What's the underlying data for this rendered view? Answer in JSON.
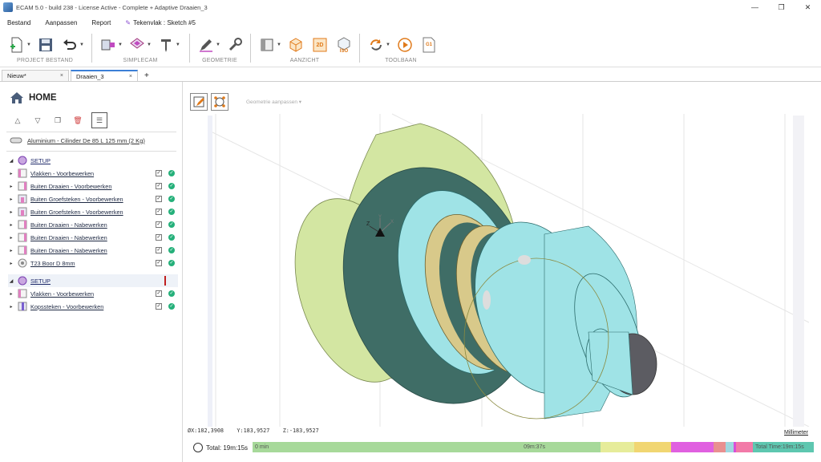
{
  "window": {
    "title": "ECAM 5.0 - build 238 - License Active - Complete + Adaptive Draaien_3",
    "controls": [
      "—",
      "❐",
      "✕"
    ]
  },
  "menu": {
    "items": [
      "Bestand",
      "Aanpassen",
      "Report"
    ],
    "sketch_label": "Tekenvlak : Sketch #5"
  },
  "ribbon": {
    "groups": [
      "PROJECT BESTAND",
      "SIMPLECAM",
      "GEOMETRIE",
      "AANZICHT",
      "TOOLBAAN"
    ],
    "view_2d": "2D",
    "view_iso": "ISO",
    "g1_label": "G1"
  },
  "tabs": [
    {
      "label": "Nieuw*",
      "close": "×"
    },
    {
      "label": "Draaien_3",
      "close": "×"
    }
  ],
  "tab_add": "+",
  "sidebar": {
    "home_label": "HOME",
    "material": "Aluminium - Cilinder De 85 L 125 mm (2 Kg)",
    "setup1": {
      "label": "SETUP",
      "operations": [
        "Vlakken - Voorbewerken",
        "Buiten Draaien - Voorbewerken",
        "Buiten Groefsteken - Voorbewerken",
        "Buiten Groefsteken - Voorbewerken",
        "Buiten Draaien - Nabewerken",
        "Buiten Draaien - Nabewerken",
        "Buiten Draaien - Nabewerken",
        "T23 Boor D 8mm"
      ]
    },
    "setup2": {
      "label": "SETUP",
      "operations": [
        "Vlakken - Voorbewerken",
        "Kopssteken - Voorbewerken"
      ]
    }
  },
  "viewport": {
    "geometry_dropdown": "Geometrie aanpassen",
    "coords": {
      "x": "ØX:182,3908",
      "y": "Y:183,9527",
      "z": "Z:-183,9527"
    },
    "units": "Millimeter",
    "axis_labels": {
      "z": "Z",
      "x": "X",
      "y": "Y"
    }
  },
  "status": {
    "total": "Total: 19m:15s",
    "timeline": {
      "start": "0 min",
      "mid": "09m:37s",
      "end": "Total Time:19m:15s",
      "segments": [
        {
          "color": "#a7d99a",
          "fraction": 0.62
        },
        {
          "color": "#e6ec9a",
          "fraction": 0.06
        },
        {
          "color": "#f1d672",
          "fraction": 0.066
        },
        {
          "color": "#e060e0",
          "fraction": 0.075
        },
        {
          "color": "#e89090",
          "fraction": 0.022
        },
        {
          "color": "#9fd8e0",
          "fraction": 0.014
        },
        {
          "color": "#d84fd8",
          "fraction": 0.004
        },
        {
          "color": "#f27aa8",
          "fraction": 0.03
        },
        {
          "color": "#5ec7b0",
          "fraction": 0.109
        }
      ]
    }
  }
}
